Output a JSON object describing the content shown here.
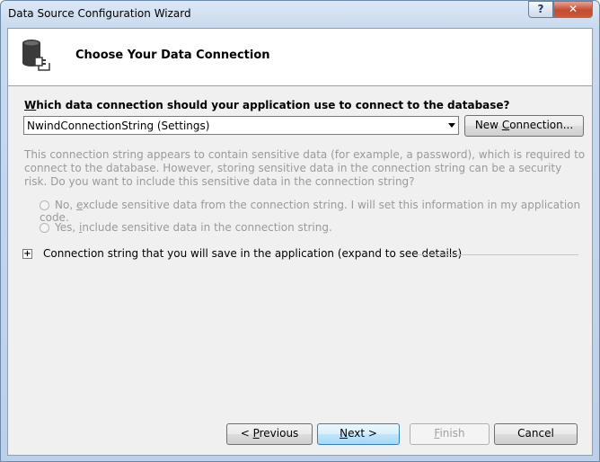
{
  "window": {
    "title": "Data Source Configuration Wizard",
    "help_label": "?",
    "close_label": "✕"
  },
  "header": {
    "title": "Choose Your Data Connection",
    "icon": "database-plug-icon"
  },
  "connection": {
    "question_prefix": "",
    "question_mnemonic": "W",
    "question_rest": "hich data connection should your application use to connect to the database?",
    "selected_value": "NwindConnectionString (Settings)",
    "new_connection_prefix": "New ",
    "new_connection_mnemonic": "C",
    "new_connection_rest": "onnection..."
  },
  "sensitive": {
    "description": "This connection string appears to contain sensitive data (for example, a password), which is required to connect to the database. However, storing sensitive data in the connection string can be a security risk. Do you want to include this sensitive data in the connection string?",
    "option_no_prefix": "No, ",
    "option_no_mnemonic": "e",
    "option_no_rest": "xclude sensitive data from the connection string. I will set this information in my application code.",
    "option_yes_prefix": "Yes, ",
    "option_yes_mnemonic": "i",
    "option_yes_rest": "nclude sensitive data in the connection string."
  },
  "expander": {
    "symbol": "+",
    "label": "Connection string that you will save in the application (expand to see details)"
  },
  "footer": {
    "previous_prefix": "< ",
    "previous_mnemonic": "P",
    "previous_rest": "revious",
    "next_mnemonic": "N",
    "next_rest": "ext >",
    "finish_mnemonic": "F",
    "finish_rest": "inish",
    "cancel": "Cancel"
  }
}
